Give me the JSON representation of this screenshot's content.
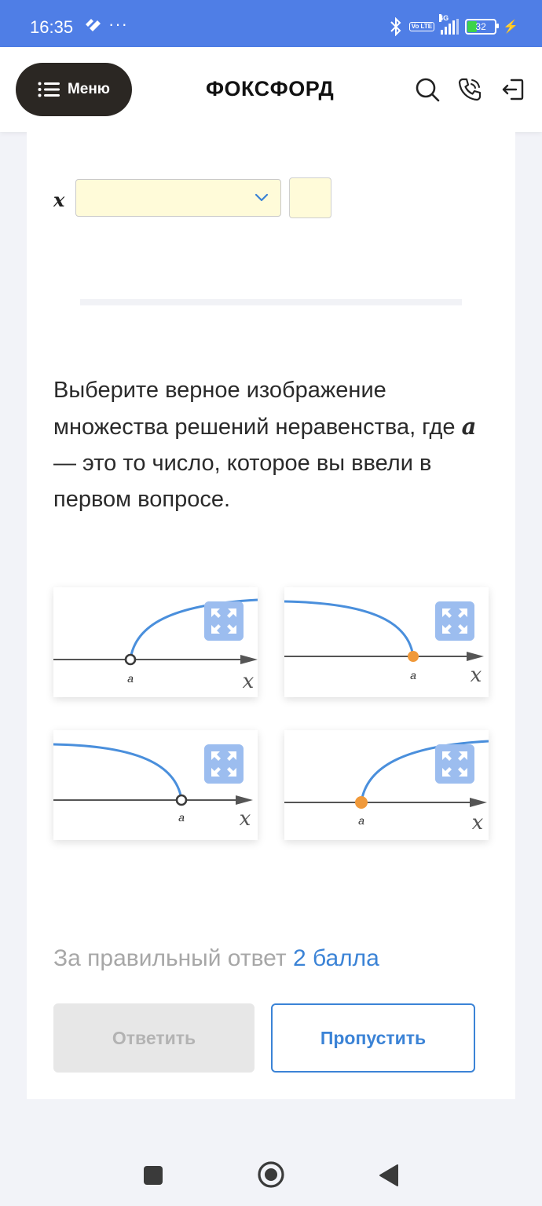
{
  "status_bar": {
    "time": "16:35",
    "more": "···",
    "network": "4G",
    "volte": "Vo LTE",
    "battery": "32"
  },
  "header": {
    "menu_label": "Меню",
    "logo": "ФОКСФОРД",
    "icons": [
      "search-icon",
      "phone-icon",
      "logout-icon"
    ]
  },
  "form": {
    "variable_label": "x",
    "dropdown_value": "",
    "number_value": ""
  },
  "question": {
    "text_before": "Выберите верное изображение множества решений неравенства, где ",
    "variable": "a",
    "text_after": " — это то число, которое вы ввели в первом вопросе."
  },
  "options": [
    {
      "point_label": "a",
      "axis_label": "x",
      "point_type": "open",
      "direction": "right"
    },
    {
      "point_label": "a",
      "axis_label": "x",
      "point_type": "closed",
      "direction": "left"
    },
    {
      "point_label": "a",
      "axis_label": "x",
      "point_type": "open",
      "direction": "left"
    },
    {
      "point_label": "a",
      "axis_label": "x",
      "point_type": "closed",
      "direction": "right"
    }
  ],
  "points": {
    "prefix": "За правильный ответ ",
    "value": "2 балла"
  },
  "buttons": {
    "answer": "Ответить",
    "skip": "Пропустить"
  },
  "colors": {
    "status_bar": "#4f7ee6",
    "accent": "#3b83d6",
    "curve": "#4a8fdc",
    "point_closed": "#f0993a",
    "input_bg": "#fffbd9"
  }
}
